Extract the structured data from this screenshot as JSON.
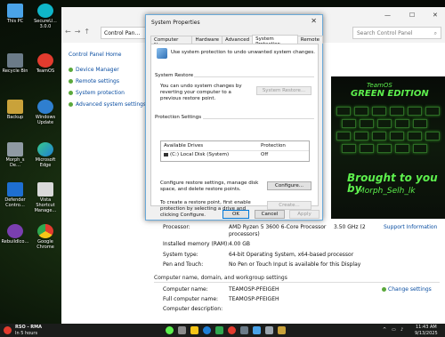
{
  "desktop": {
    "icons": [
      "This PC",
      "SecureU… 3.0.0",
      "Recycle Bin",
      "TeamOS",
      "Backup",
      "Windows Update",
      "Morph_s De…",
      "Microsoft Edge",
      "Defender Contro…",
      "Vista Shortcut Manage…",
      "RebuildIco…",
      "Google Chrome"
    ]
  },
  "control_panel": {
    "address": "Control Pan…",
    "search_placeholder": "Search Control Panel",
    "left": {
      "home": "Control Panel Home",
      "links": [
        "Device Manager",
        "Remote settings",
        "System protection",
        "Advanced system settings"
      ]
    },
    "banner": {
      "line1": "TeamOS",
      "line2": "GREEN EDITION",
      "line3": "Brought to you by",
      "line4": "Morph_Selh_lk"
    },
    "system": {
      "processor_label": "Processor:",
      "processor_value": "AMD Ryzen 5 3600 6-Core Processor",
      "processor_value2": "processors)",
      "processor_speed": "3.50 GHz (2",
      "support": "Support Information",
      "ram_label": "Installed memory (RAM):",
      "ram_value": "4.00 GB",
      "type_label": "System type:",
      "type_value": "64-bit Operating System, x64-based processor",
      "pen_label": "Pen and Touch:",
      "pen_value": "No Pen or Touch Input is available for this Display"
    },
    "computer": {
      "section": "Computer name, domain, and workgroup settings",
      "name_label": "Computer name:",
      "name_value": "TEAMOSP-PFEIGEH",
      "full_label": "Full computer name:",
      "full_value": "TEAMOSP-PFEIGEH",
      "desc_label": "Computer description:",
      "change": "Change settings"
    }
  },
  "dialog": {
    "title": "System Properties",
    "tabs": [
      "Computer Name",
      "Hardware",
      "Advanced",
      "System Protection",
      "Remote"
    ],
    "active_tab": 3,
    "intro": "Use system protection to undo unwanted system changes.",
    "restore": {
      "heading": "System Restore",
      "text": "You can undo system changes by reverting your computer to a previous restore point.",
      "button": "System Restore..."
    },
    "protection": {
      "heading": "Protection Settings",
      "col1": "Available Drives",
      "col2": "Protection",
      "drive": "(C:) Local Disk (System)",
      "state": "Off",
      "configure_text": "Configure restore settings, manage disk space, and delete restore points.",
      "configure_button": "Configure...",
      "create_text": "To create a restore point, first enable protection by selecting a drive and clicking Configure.",
      "create_button": "Create..."
    },
    "ok": "OK",
    "cancel": "Cancel",
    "apply": "Apply"
  },
  "taskbar": {
    "app_title": "RSO - RMA",
    "app_sub": "In 5 hours",
    "time": "11:43 AM",
    "date": "9/13/2025"
  }
}
